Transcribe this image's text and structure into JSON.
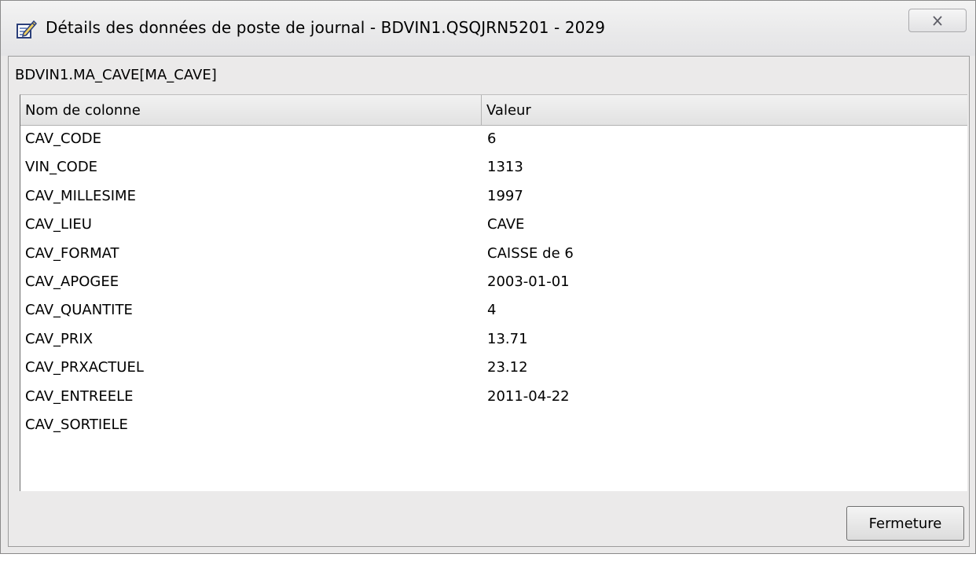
{
  "window": {
    "title": "Détails des données de poste de journal - BDVIN1.QSQJRN5201 - 2029",
    "icon": "edit-document-icon",
    "close_icon": "close-x-icon"
  },
  "file_label": "BDVIN1.MA_CAVE[MA_CAVE]",
  "table": {
    "columns": [
      "Nom de colonne",
      "Valeur"
    ],
    "rows": [
      {
        "name": "CAV_CODE",
        "value": "6"
      },
      {
        "name": "VIN_CODE",
        "value": "1313"
      },
      {
        "name": "CAV_MILLESIME",
        "value": "1997"
      },
      {
        "name": "CAV_LIEU",
        "value": "CAVE"
      },
      {
        "name": "CAV_FORMAT",
        "value": "CAISSE de 6"
      },
      {
        "name": "CAV_APOGEE",
        "value": "2003-01-01"
      },
      {
        "name": "CAV_QUANTITE",
        "value": "4"
      },
      {
        "name": "CAV_PRIX",
        "value": "13.71"
      },
      {
        "name": "CAV_PRXACTUEL",
        "value": "23.12"
      },
      {
        "name": "CAV_ENTREELE",
        "value": "2011-04-22"
      },
      {
        "name": "CAV_SORTIELE",
        "value": ""
      }
    ]
  },
  "buttons": {
    "close_label": "Fermeture"
  }
}
